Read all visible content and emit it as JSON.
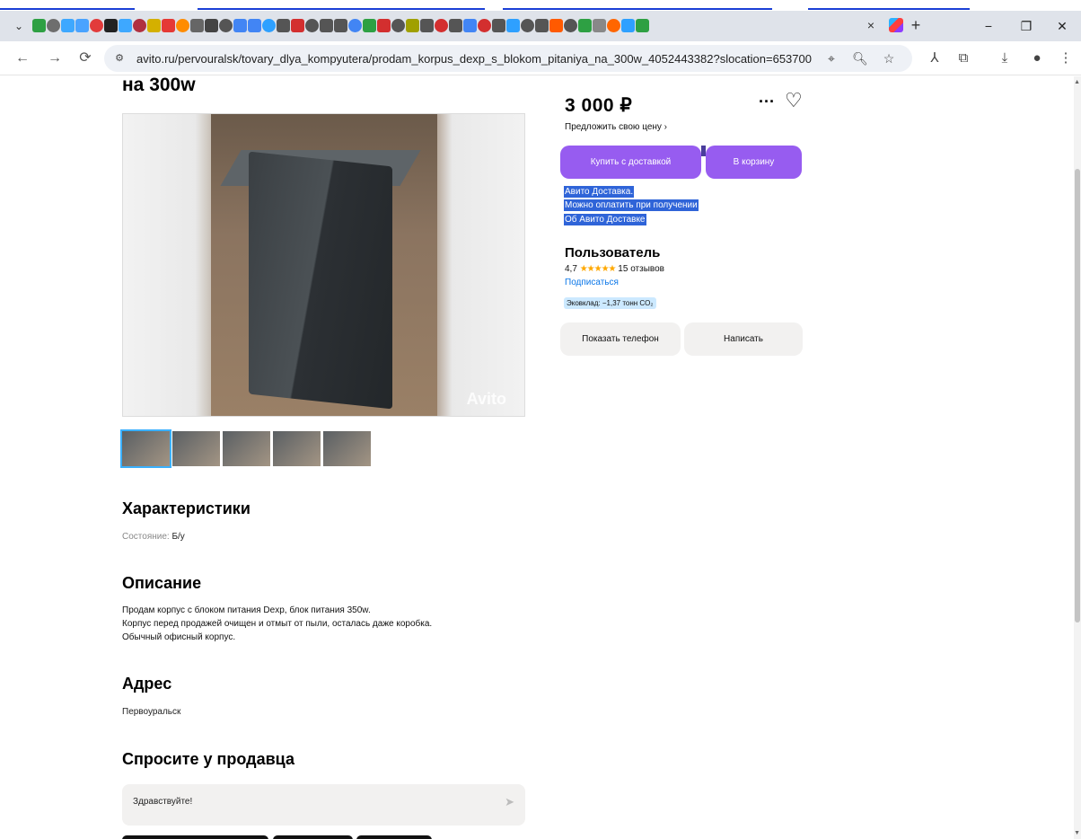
{
  "browser": {
    "tab_close": "×",
    "new_tab": "+",
    "window": {
      "minimize": "−",
      "restore": "❐",
      "close": "✕"
    },
    "nav": {
      "back": "←",
      "forward": "→",
      "reload": "⟳"
    },
    "url": "avito.ru/pervouralsk/tovary_dlya_kompyutera/prodam_korpus_dexp_s_blokom_pitaniya_na_300w_4052443382?slocation=653700",
    "favicon_colors": [
      "#2ea043",
      "#6e6e6e",
      "#3ea8ff",
      "#4aa3ff",
      "#e23b3b",
      "#222222",
      "#3ea8ff",
      "#b03040",
      "#d4b000",
      "#e53935",
      "#ff8c00",
      "#666666",
      "#444444",
      "#555555",
      "#4285f4",
      "#4285f4",
      "#2ea0ff",
      "#555555",
      "#d32f2f",
      "#555555",
      "#555555",
      "#555555",
      "#4285f4",
      "#2ea043",
      "#d32f2f",
      "#555555",
      "#a0a000",
      "#555555",
      "#d32f2f",
      "#555555",
      "#4285f4",
      "#d32f2f",
      "#555555",
      "#2ea0ff",
      "#555555",
      "#555555",
      "#ff5a00",
      "#555555",
      "#2ea043",
      "#888888",
      "#ff6600",
      "#2ea0ff",
      "#2ea043"
    ]
  },
  "listing": {
    "title": "на 300w",
    "photo_watermark": "Avito",
    "thumb_count": 5,
    "characteristics": {
      "heading": "Характеристики",
      "condition_label": "Состояние:",
      "condition_value": "Б/у"
    },
    "description": {
      "heading": "Описание",
      "lines": [
        "Продам корпус с блоком питания Dexp, блок питания 350w.",
        "Корпус перед продажей очищен и отмыт от пыли, осталась даже коробка.",
        "Обычный офисный корпус."
      ]
    },
    "address": {
      "heading": "Адрес",
      "value": "Первоуральск"
    },
    "ask": {
      "heading": "Спросите у продавца",
      "message": "Здравствуйте!"
    }
  },
  "sidebar": {
    "price": "3 000 ₽",
    "offer_price": "Предложить свою цену ›",
    "buy_delivery": "Купить с доставкой",
    "to_cart": "В корзину",
    "delivery_lines": [
      "Авито Доставка.",
      "Можно оплатить при получении",
      "Об Авито Доставке"
    ],
    "seller": {
      "name": "Пользователь",
      "rating": "4,7",
      "stars": "★★★★★",
      "reviews": "15 отзывов",
      "subscribe": "Подписаться",
      "eco": "Эковклад: −1,37 тонн CO₂"
    },
    "show_phone": "Показать телефон",
    "write": "Написать",
    "accent": "#975cf0"
  }
}
